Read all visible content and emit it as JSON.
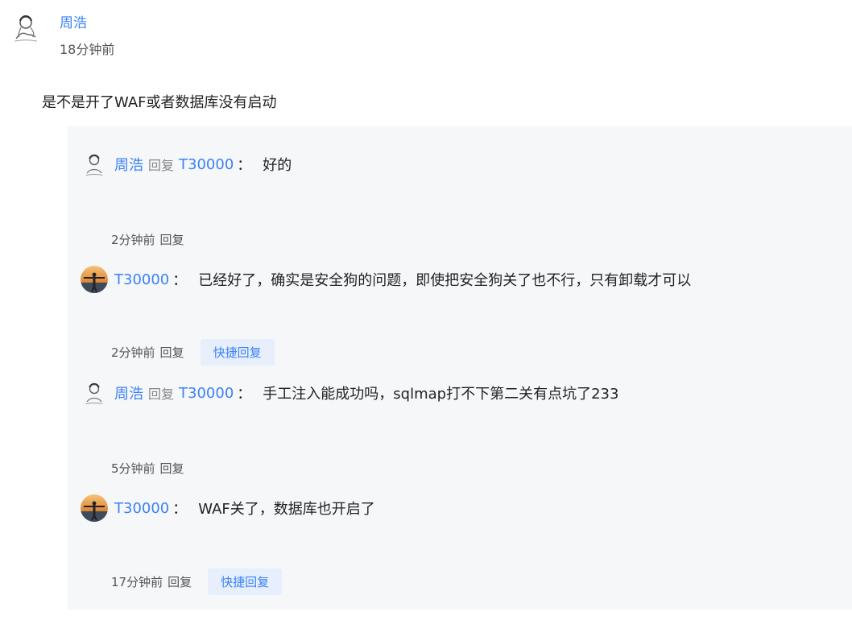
{
  "comment": {
    "author": "周浩",
    "time": "18分钟前",
    "content": "是不是开了WAF或者数据库没有启动"
  },
  "replies": [
    {
      "author": "周浩",
      "reply_word": "回复",
      "target": "T30000",
      "colon": "：",
      "text": "好的",
      "time": "2分钟前",
      "reply_label": "回复",
      "avatar": "sketch-avatar"
    },
    {
      "author": "T30000",
      "colon": "：",
      "text": "已经好了，确实是安全狗的问题，即使把安全狗关了也不行，只有卸载才可以",
      "time": "2分钟前",
      "reply_label": "回复",
      "quick_reply": "快捷回复",
      "avatar": "sunset-avatar"
    },
    {
      "author": "周浩",
      "reply_word": "回复",
      "target": "T30000",
      "colon": "：",
      "text": "手工注入能成功吗，sqlmap打不下第二关有点坑了233",
      "time": "5分钟前",
      "reply_label": "回复",
      "avatar": "sketch-avatar"
    },
    {
      "author": "T30000",
      "colon": "：",
      "text": "WAF关了，数据库也开启了",
      "time": "17分钟前",
      "reply_label": "回复",
      "quick_reply": "快捷回复",
      "avatar": "sunset-avatar"
    }
  ],
  "colors": {
    "link": "#3b82f6",
    "reply_bg": "#f6f7f9",
    "quick_bg": "#e7effc"
  }
}
